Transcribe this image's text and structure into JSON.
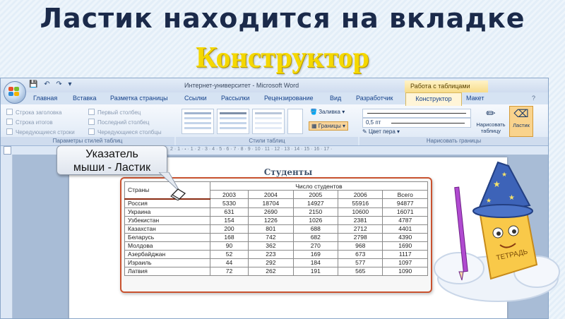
{
  "slide": {
    "title": "Ластик находится на вкладке",
    "subtitle": "Конструктор"
  },
  "word": {
    "window_title": "Интернет-университет - Microsoft Word",
    "context_tab_group": "Работа с таблицами",
    "tabs": [
      "Главная",
      "Вставка",
      "Разметка страницы",
      "Ссылки",
      "Рассылки",
      "Рецензирование",
      "Вид",
      "Разработчик",
      "Конструктор",
      "Макет"
    ],
    "active_tab": "Конструктор",
    "ribbon": {
      "group1_label": "Параметры стилей таблиц",
      "group1_options": [
        "Строка заголовка",
        "Первый столбец",
        "Строка итогов",
        "Последний столбец",
        "Чередующиеся строки",
        "Чередующиеся столбцы"
      ],
      "group2_label": "Стили таблиц",
      "fill_button": "Заливка",
      "borders_button": "Границы",
      "group3_label": "Нарисовать границы",
      "line_width": "0,5 пт",
      "pen_color": "Цвет пера",
      "draw_table_button": "Нарисовать таблицу",
      "eraser_button": "Ластик"
    },
    "ruler_text": "2 · 1 · 🞄 · 1 · 2 · 3 · 4 · 5 · 6 · 7 · 8 · 9 · 10 · 11 · 12 · 13 · 14 · 15 · 16 · 17 ·",
    "document": {
      "title": "Студенты",
      "table": {
        "corner": "Страны",
        "group_header": "Число студентов",
        "columns": [
          "2003",
          "2004",
          "2005",
          "2006",
          "Всего"
        ],
        "rows": [
          [
            "Россия",
            "5330",
            "18704",
            "14927",
            "55916",
            "94877"
          ],
          [
            "Украина",
            "631",
            "2690",
            "2150",
            "10600",
            "16071"
          ],
          [
            "Узбекистан",
            "154",
            "1226",
            "1026",
            "2381",
            "4787"
          ],
          [
            "Казахстан",
            "200",
            "801",
            "688",
            "2712",
            "4401"
          ],
          [
            "Беларусь",
            "168",
            "742",
            "682",
            "2798",
            "4390"
          ],
          [
            "Молдова",
            "90",
            "362",
            "270",
            "968",
            "1690"
          ],
          [
            "Азербайджан",
            "52",
            "223",
            "169",
            "673",
            "1117"
          ],
          [
            "Израиль",
            "44",
            "292",
            "184",
            "577",
            "1097"
          ],
          [
            "Латвия",
            "72",
            "262",
            "191",
            "565",
            "1090"
          ]
        ]
      }
    }
  },
  "callout": {
    "line1": "Указатель",
    "line2": "мыши - Ластик"
  },
  "mascot": {
    "label": "ТЕТРАДЬ"
  }
}
